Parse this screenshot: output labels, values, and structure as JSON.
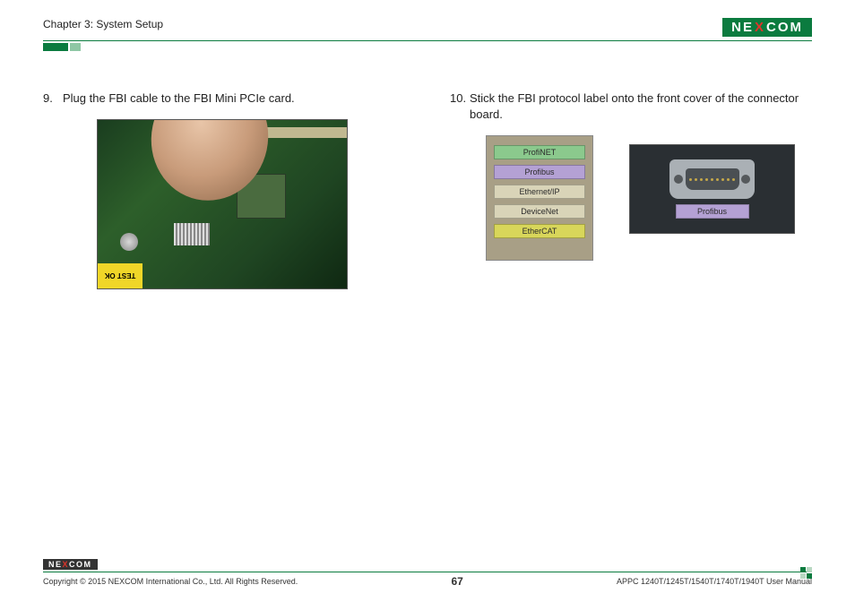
{
  "header": {
    "chapter": "Chapter 3: System Setup",
    "logo_parts": {
      "pre": "NE",
      "x": "X",
      "post": "COM"
    }
  },
  "steps": {
    "s9": {
      "num": "9.",
      "text": "Plug the FBI cable to the FBI Mini PCIe card."
    },
    "s10": {
      "num": "10.",
      "text": "Stick the FBI protocol label onto the front cover of the connector board."
    }
  },
  "pcb": {
    "yellow_tag": "TEST OK"
  },
  "protocol_labels": {
    "profinet": "ProfiNET",
    "profibus": "Profibus",
    "ethernetip": "Ethernet/IP",
    "devicenet": "DeviceNet",
    "ethercat": "EtherCAT"
  },
  "connector_plate": {
    "label": "Profibus"
  },
  "footer": {
    "logo_parts": {
      "pre": "NE",
      "x": "X",
      "post": "COM"
    },
    "copyright": "Copyright © 2015 NEXCOM International Co., Ltd. All Rights Reserved.",
    "page": "67",
    "manual": "APPC 1240T/1245T/1540T/1740T/1940T User Manual"
  }
}
